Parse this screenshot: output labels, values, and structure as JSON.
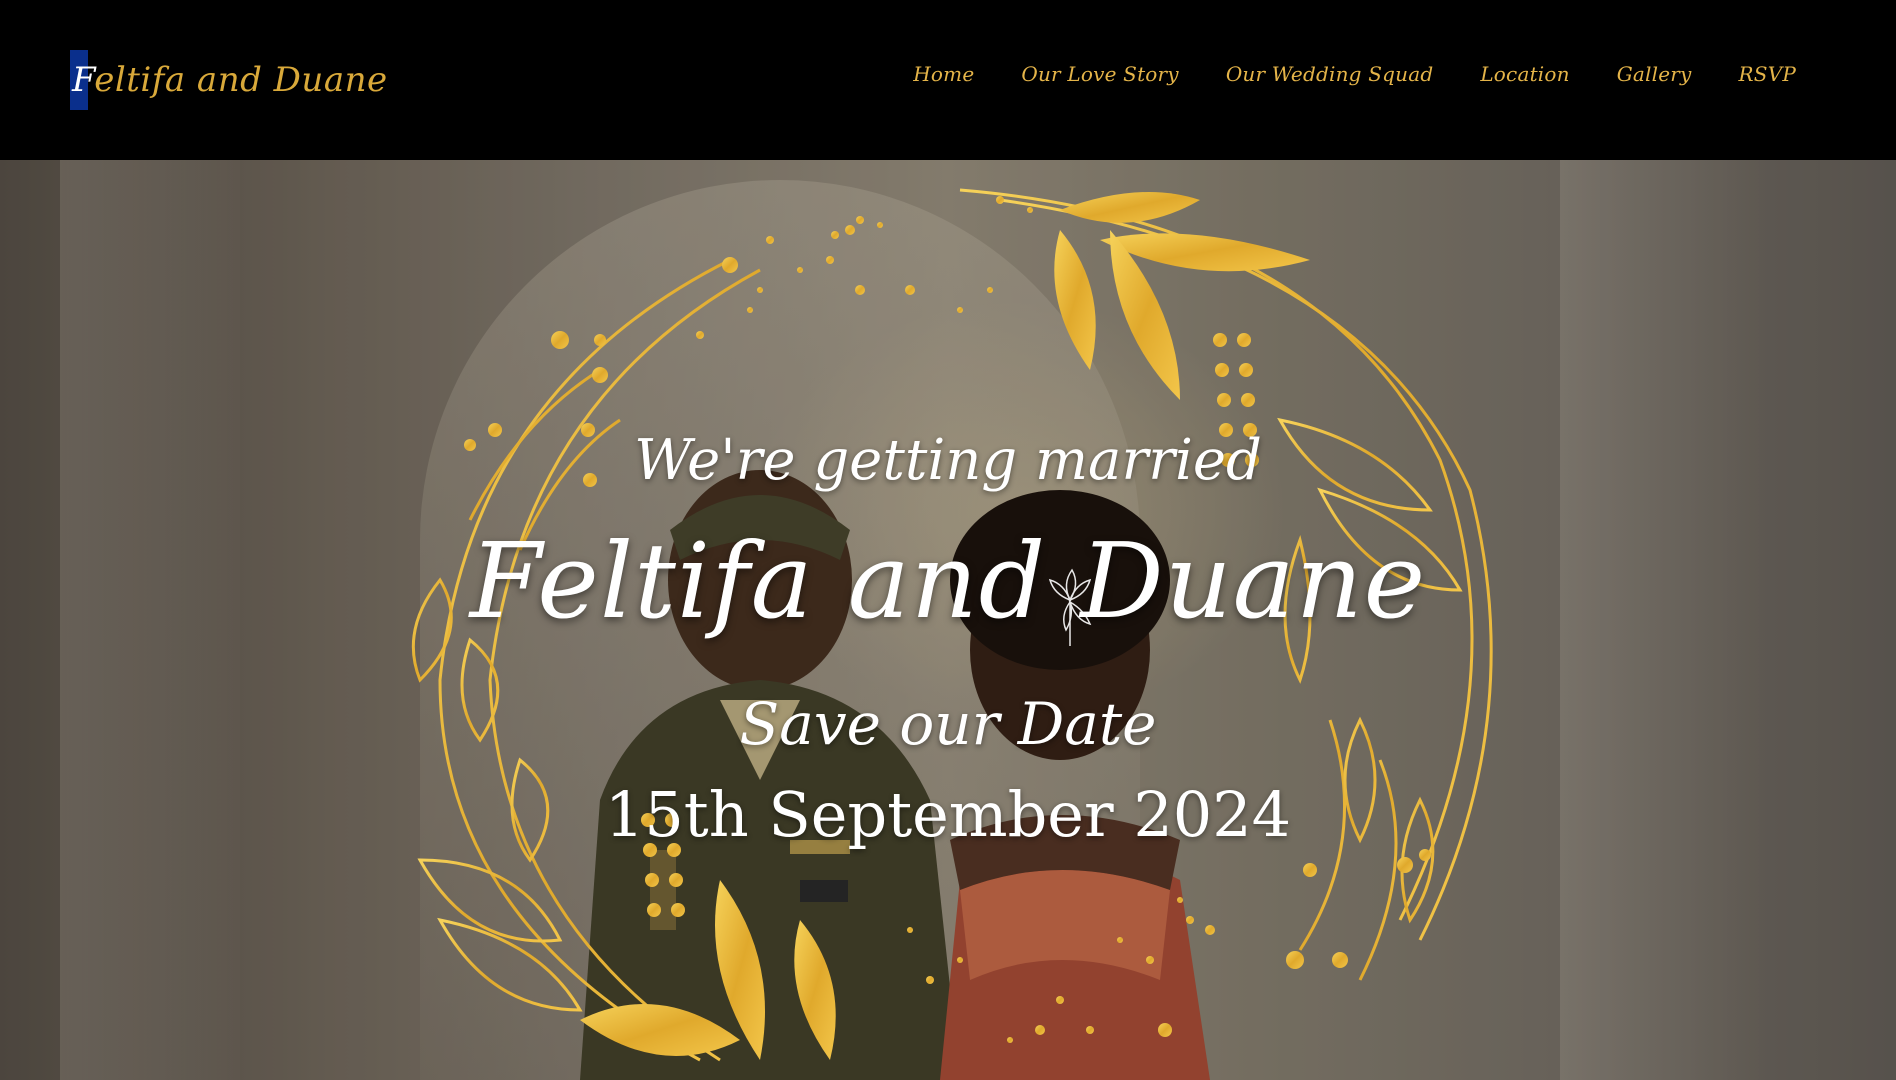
{
  "brand": {
    "first_letter": "F",
    "rest": "eltifa and Duane"
  },
  "nav": {
    "items": [
      {
        "label": "Home"
      },
      {
        "label": "Our Love Story"
      },
      {
        "label": "Our Wedding Squad"
      },
      {
        "label": "Location"
      },
      {
        "label": "Gallery"
      },
      {
        "label": "RSVP"
      }
    ]
  },
  "hero": {
    "tagline": "We're getting married",
    "couple_names": "Feltifa and Duane",
    "save_text": "Save our Date",
    "date": "15th September 2024"
  },
  "colors": {
    "accent_gold": "#e4b449",
    "brand_blue": "#0a2f8c",
    "header_bg": "#000000",
    "text_white": "#ffffff"
  },
  "icons": {
    "wreath": "gold-floral-wreath",
    "lily": "lily-flower-icon"
  }
}
